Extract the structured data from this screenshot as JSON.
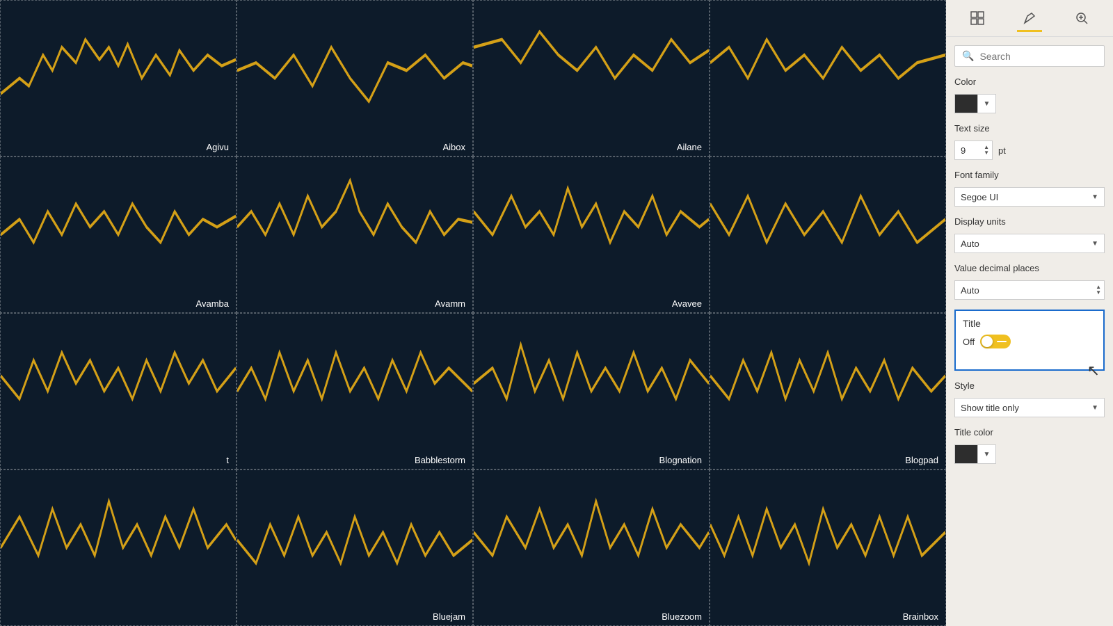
{
  "toolbar": {
    "grid_icon": "⊞",
    "paint_icon": "🖌",
    "inspect_icon": "🔍"
  },
  "panel": {
    "search_placeholder": "Search",
    "color_label": "Color",
    "text_size_label": "Text size",
    "text_size_value": "9",
    "text_size_unit": "pt",
    "font_family_label": "Font family",
    "font_family_value": "Segoe UI",
    "display_units_label": "Display units",
    "display_units_value": "Auto",
    "value_decimal_label": "Value decimal places",
    "value_decimal_value": "Auto",
    "title_label": "Title",
    "toggle_label": "Off",
    "style_label": "Style",
    "style_value": "Show title only",
    "title_color_label": "Title color"
  },
  "charts": [
    {
      "label": "Agivu",
      "col": 1
    },
    {
      "label": "Aibox",
      "col": 2
    },
    {
      "label": "Ailane",
      "col": 3
    },
    {
      "label": "",
      "col": 4
    },
    {
      "label": "Avamba",
      "col": 1
    },
    {
      "label": "Avamm",
      "col": 2
    },
    {
      "label": "Avavee",
      "col": 3
    },
    {
      "label": "",
      "col": 4
    },
    {
      "label": "t",
      "col": 1
    },
    {
      "label": "Babblestorm",
      "col": 2
    },
    {
      "label": "Blognation",
      "col": 3
    },
    {
      "label": "Blogpad",
      "col": 4
    },
    {
      "label": "",
      "col": 1
    },
    {
      "label": "Bluejam",
      "col": 2
    },
    {
      "label": "Bluezoom",
      "col": 3
    },
    {
      "label": "Brainbox",
      "col": 4
    }
  ]
}
